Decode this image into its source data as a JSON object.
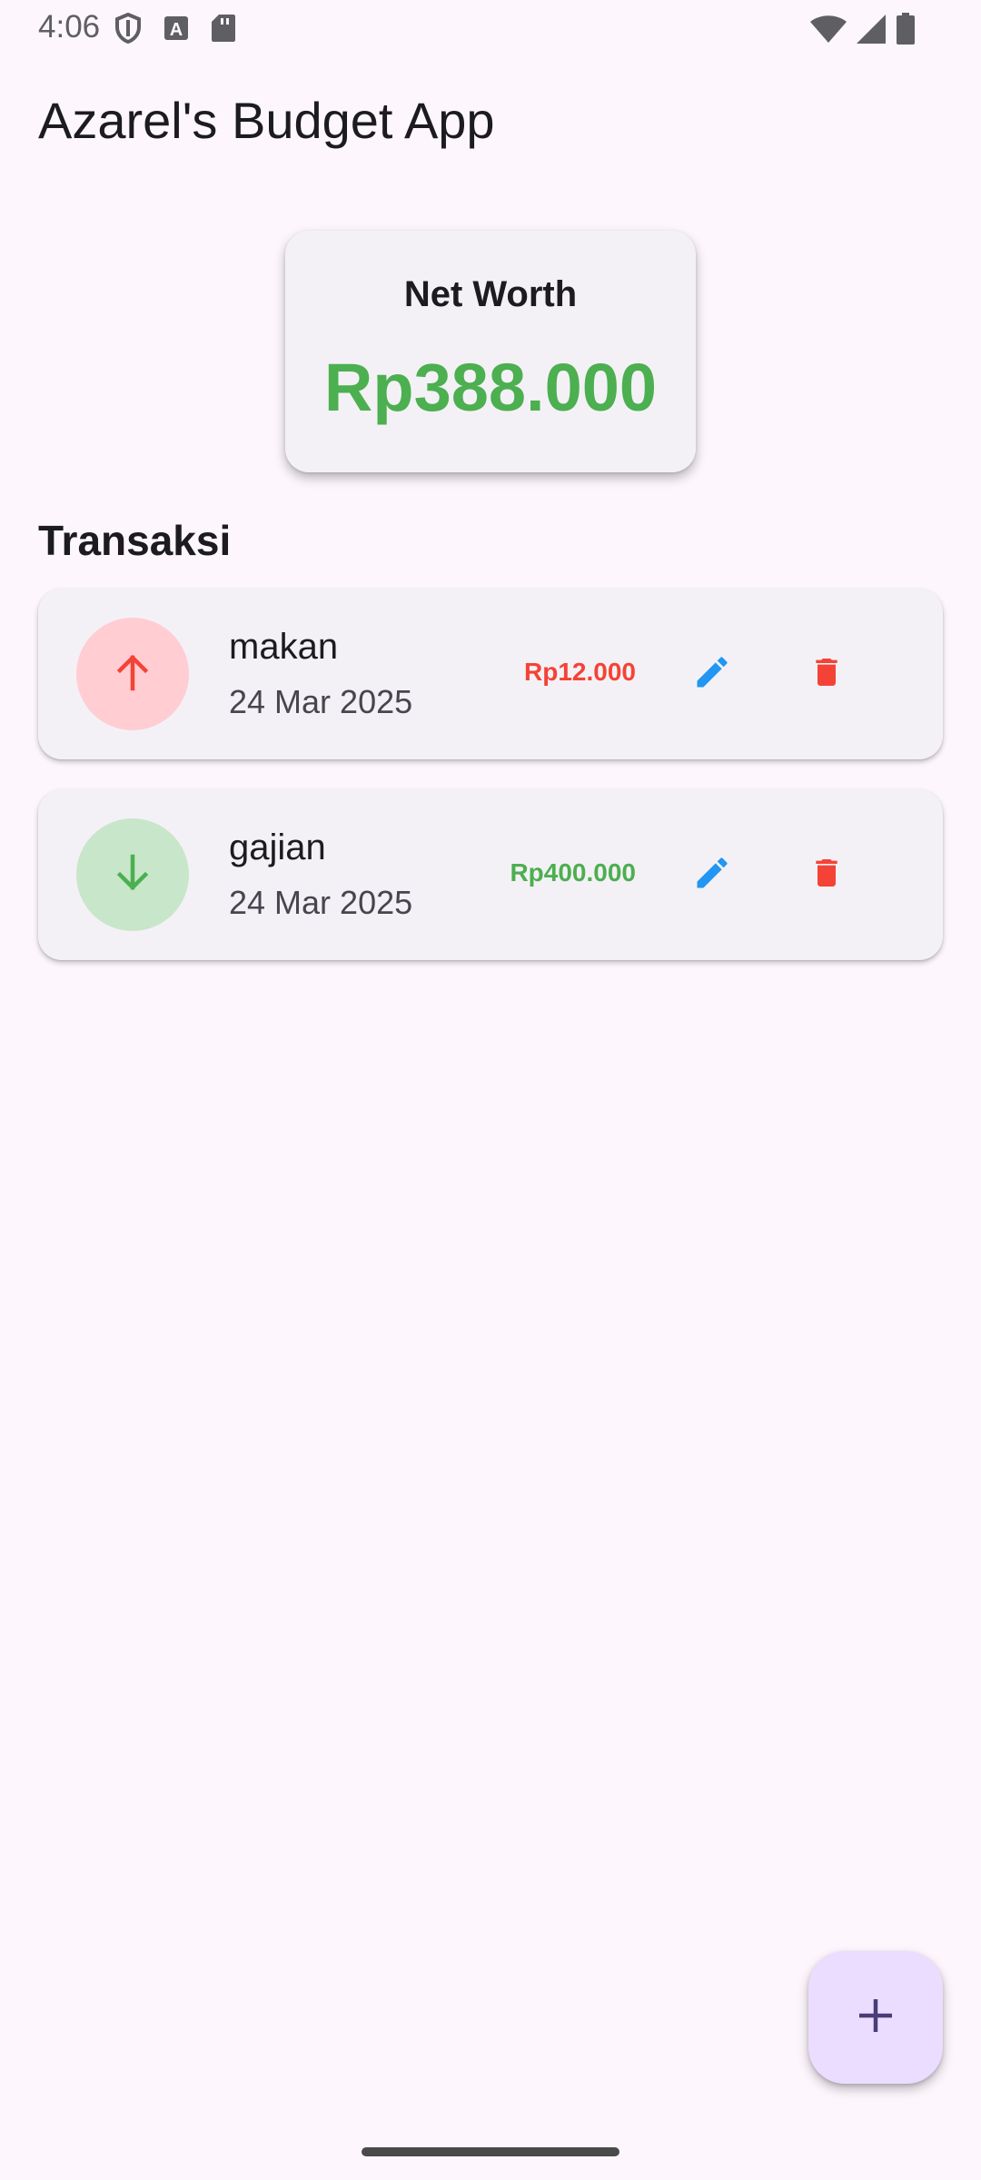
{
  "status_bar": {
    "time": "4:06",
    "left_icons": [
      "shield-icon",
      "font-a-icon",
      "sd-card-icon"
    ],
    "right_icons": [
      "wifi-icon",
      "cell-signal-icon",
      "battery-icon"
    ]
  },
  "app_bar": {
    "title": "Azarel's Budget App"
  },
  "net_worth": {
    "title": "Net Worth",
    "value": "Rp388.000",
    "color": "#4caf50"
  },
  "transactions_section": {
    "title": "Transaksi",
    "items": [
      {
        "name": "makan",
        "date": "24 Mar 2025",
        "amount": "Rp12.000",
        "type": "expense",
        "icon": "arrow-up-icon",
        "color": "#f44336"
      },
      {
        "name": "gajian",
        "date": "24 Mar 2025",
        "amount": "Rp400.000",
        "type": "income",
        "icon": "arrow-down-icon",
        "color": "#4caf50"
      }
    ]
  },
  "actions": {
    "edit_icon": "pencil-icon",
    "delete_icon": "trash-icon",
    "edit_color": "#2196f3",
    "delete_color": "#f44336"
  },
  "fab": {
    "icon": "plus-icon"
  }
}
